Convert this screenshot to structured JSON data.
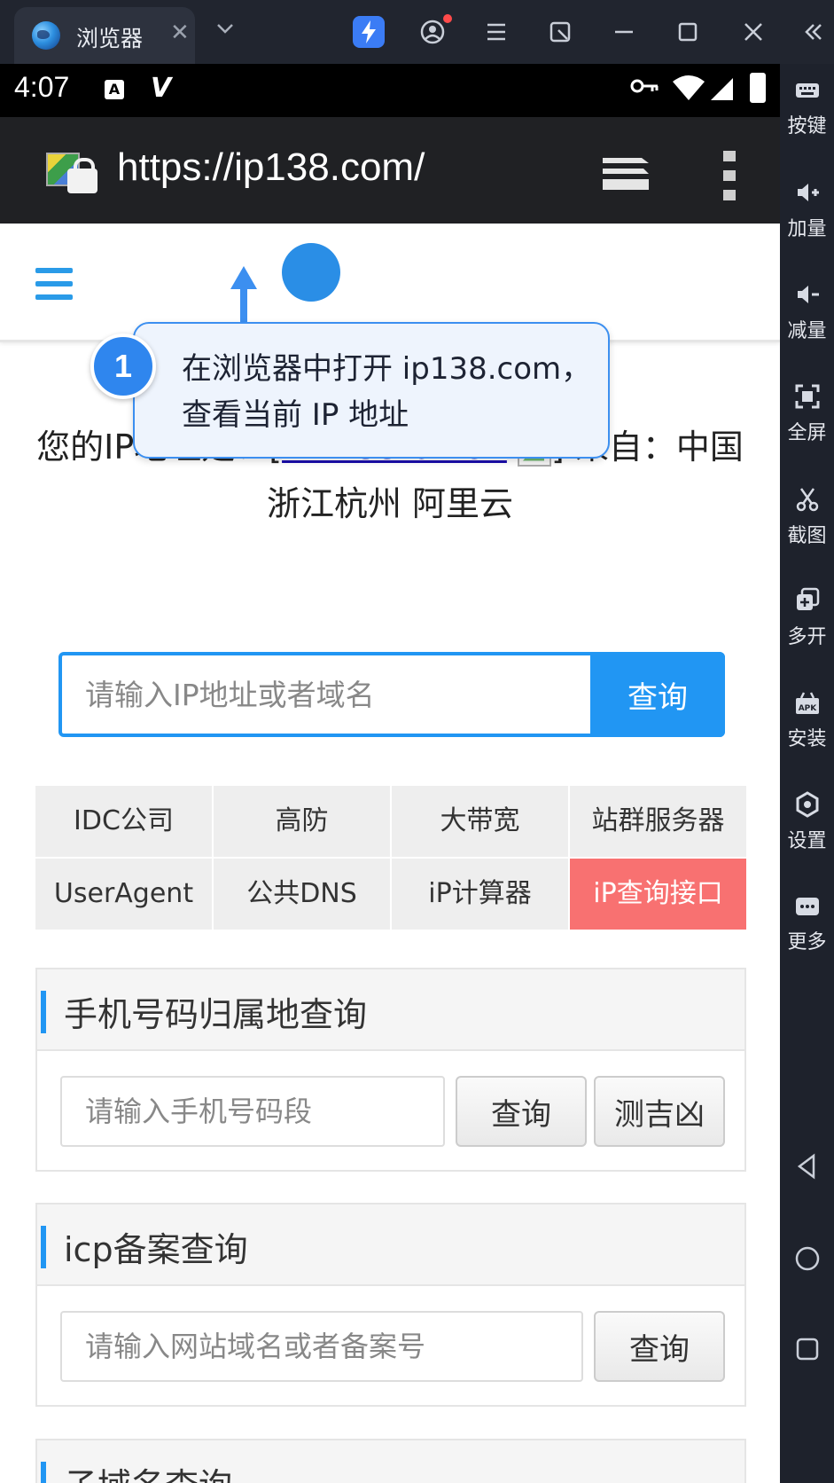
{
  "window": {
    "tab_title": "浏览器",
    "tab_close": "✕",
    "icons": [
      "globe-icon",
      "lightning-icon",
      "account-icon",
      "menu-icon",
      "screenshot-icon",
      "minimize-icon",
      "maximize-icon",
      "close-icon",
      "collapse-icon"
    ]
  },
  "status_bar": {
    "time": "4:07",
    "a_icon": "A",
    "v_icon": "V"
  },
  "browser": {
    "url": "https://ip138.com/"
  },
  "callout": {
    "number": "1",
    "text": "在浏览器中打开 ip138.com，查看当前 IP 地址"
  },
  "ip_info": {
    "prefix": "您的IP地址是：[",
    "ip": "114.55.61.82",
    "suffix_before_location": "] 来自：中国",
    "location": "浙江杭州 阿里云"
  },
  "search": {
    "placeholder": "请输入IP地址或者域名",
    "button": "查询"
  },
  "grid": [
    "IDC公司",
    "高防",
    "大带宽",
    "站群服务器",
    "UserAgent",
    "公共DNS",
    "iP计算器",
    "iP查询接口"
  ],
  "phone_panel": {
    "title": "手机号码归属地查询",
    "placeholder": "请输入手机号码段",
    "query_button": "查询",
    "fortune_button": "测吉凶"
  },
  "icp_panel": {
    "title": "icp备案查询",
    "placeholder": "请输入网站域名或者备案号",
    "query_button": "查询"
  },
  "subdomain_panel": {
    "title": "子域名查询"
  },
  "sidebar": {
    "items": [
      {
        "label": "按键",
        "icon": "keyboard-icon"
      },
      {
        "label": "加量",
        "icon": "volume-up-icon"
      },
      {
        "label": "减量",
        "icon": "volume-down-icon"
      },
      {
        "label": "全屏",
        "icon": "fullscreen-icon"
      },
      {
        "label": "截图",
        "icon": "scissors-icon"
      },
      {
        "label": "多开",
        "icon": "multi-instance-icon"
      },
      {
        "label": "安装",
        "icon": "apk-icon"
      },
      {
        "label": "设置",
        "icon": "settings-icon"
      },
      {
        "label": "更多",
        "icon": "more-icon"
      }
    ],
    "nav": [
      "back-icon",
      "home-icon",
      "recents-icon"
    ]
  },
  "colors": {
    "accent": "#2196f3",
    "hot_cell": "#f87171",
    "callout_border": "#3c8ff0"
  }
}
